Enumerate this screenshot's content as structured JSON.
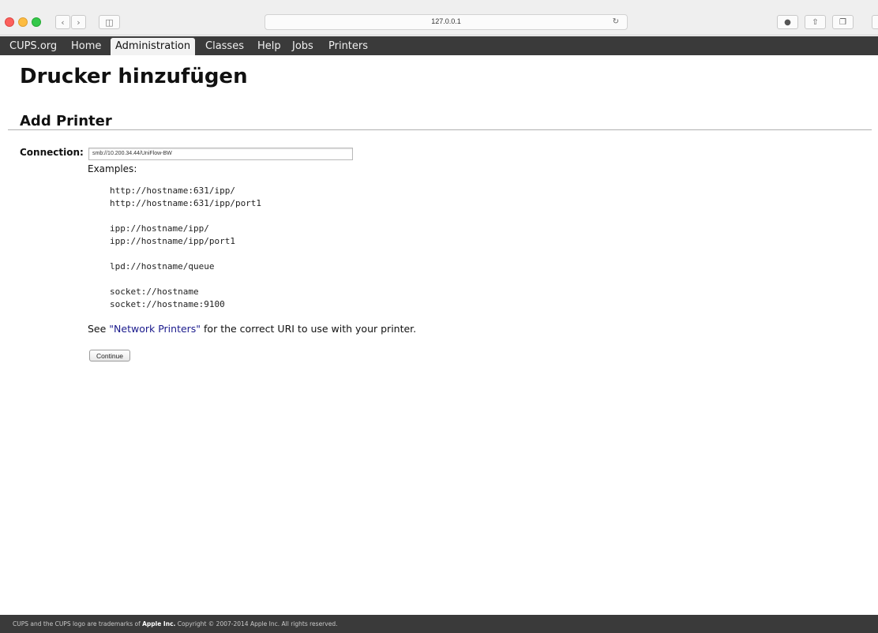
{
  "browser": {
    "url": "127.0.0.1",
    "reload_icon": "reload-icon",
    "back_icon": "chevron-left-icon",
    "forward_icon": "chevron-right-icon",
    "sidebar_icon": "sidebar-icon",
    "download_icon": "download-icon",
    "share_icon": "share-icon",
    "tabs_icon": "tabs-icon"
  },
  "nav": {
    "items": [
      {
        "label": "CUPS.org",
        "active": false
      },
      {
        "label": "Home",
        "active": false
      },
      {
        "label": "Administration",
        "active": true
      },
      {
        "label": "Classes",
        "active": false
      },
      {
        "label": "Help",
        "active": false
      },
      {
        "label": "Jobs",
        "active": false
      },
      {
        "label": "Printers",
        "active": false
      }
    ]
  },
  "page": {
    "title": "Drucker hinzufügen",
    "section_title": "Add Printer",
    "connection_label": "Connection:",
    "connection_value": "smb://10.200.34.44/UniFlow-BW",
    "examples_label": "Examples:",
    "examples": [
      "http://hostname:631/ipp/",
      "http://hostname:631/ipp/port1",
      "ipp://hostname/ipp/",
      "ipp://hostname/ipp/port1",
      "lpd://hostname/queue",
      "socket://hostname",
      "socket://hostname:9100"
    ],
    "see_prefix": "See ",
    "see_link": "\"Network Printers\"",
    "see_suffix": " for the correct URI to use with your printer.",
    "continue_label": "Continue"
  },
  "footer": {
    "prefix": "CUPS and the CUPS logo are trademarks of ",
    "company": "Apple Inc.",
    "suffix": " Copyright © 2007-2014 Apple Inc. All rights reserved."
  },
  "colors": {
    "nav_bg": "#3a3a3a",
    "link": "#1a1a8c",
    "traffic_red": "#fc605c",
    "traffic_yellow": "#fdbc40",
    "traffic_green": "#34c84a"
  }
}
